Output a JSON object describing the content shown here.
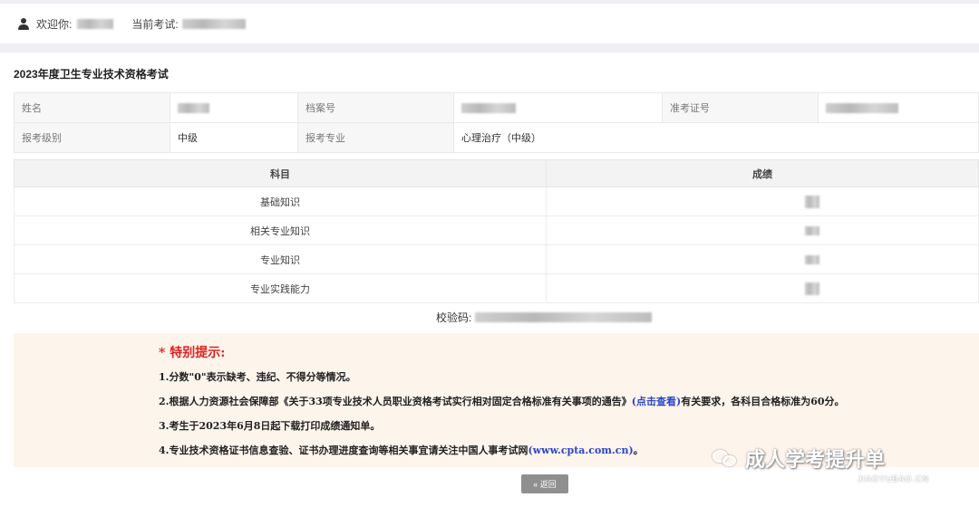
{
  "topbar": {
    "welcome_label": "欢迎你:",
    "exam_label": "当前考试:"
  },
  "exam": {
    "title": "2023年度卫生专业技术资格考试"
  },
  "info": {
    "name_label": "姓名",
    "file_no_label": "档案号",
    "ticket_no_label": "准考证号",
    "level_label": "报考级别",
    "level_value": "中级",
    "major_label": "报考专业",
    "major_value": "心理治疗（中级）"
  },
  "scores": {
    "headers": [
      "科目",
      "成绩"
    ],
    "subjects": [
      "基础知识",
      "相关专业知识",
      "专业知识",
      "专业实践能力"
    ]
  },
  "verify": {
    "label": "校验码:"
  },
  "notice": {
    "title": "* 特别提示:",
    "line1": "1.分数\"0\"表示缺考、违纪、不得分等情况。",
    "line2_pre": "2.根据人力资源社会保障部《关于33项专业技术人员职业资格考试实行相对固定合格标准有关事项的通告》",
    "line2_link": "(点击查看)",
    "line2_post": "有关要求，各科目合格标准为60分。",
    "line3": "3.考生于2023年6月8日起下载打印成绩通知单。",
    "line4_pre": "4.专业技术资格证书信息查验、证书办理进度查询等相关事宜请关注中国人事考试网",
    "line4_link": "(www.cpta.com.cn)",
    "line4_post": "。"
  },
  "back_button": {
    "label": "« 返回"
  },
  "watermark": {
    "text": "成人学考提升单",
    "sub": "JIAOYUBAO.CN"
  }
}
